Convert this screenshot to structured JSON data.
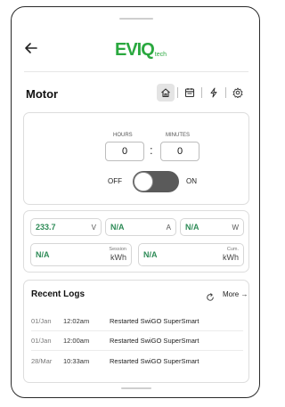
{
  "header": {
    "logo_main": "EVIQ",
    "logo_sub": "tech"
  },
  "device": {
    "title": "Motor",
    "nav": [
      {
        "icon": "home-icon",
        "active": true
      },
      {
        "icon": "calendar-icon",
        "active": false
      },
      {
        "icon": "lightning-icon",
        "active": false
      },
      {
        "icon": "gear-icon",
        "active": false
      }
    ]
  },
  "timer": {
    "hours_label": "HOURS",
    "minutes_label": "MINUTES",
    "hours_value": "0",
    "minutes_value": "0",
    "separator": ":",
    "off_label": "OFF",
    "on_label": "ON",
    "toggle_state": "off"
  },
  "metrics": {
    "voltage": {
      "value": "233.7",
      "unit": "V"
    },
    "current": {
      "value": "N/A",
      "unit": "A"
    },
    "power": {
      "value": "N/A",
      "unit": "W"
    },
    "session": {
      "value": "N/A",
      "label": "Session",
      "unit": "kWh"
    },
    "cumulative": {
      "value": "N/A",
      "label": "Cum.",
      "unit": "kWh"
    }
  },
  "logs": {
    "title": "Recent Logs",
    "more_label": "More",
    "more_arrow": "→",
    "rows": [
      {
        "date": "01/Jan",
        "time": "12:02am",
        "message": "Restarted SwiGO SuperSmart"
      },
      {
        "date": "01/Jan",
        "time": "12:00am",
        "message": "Restarted SwiGO SuperSmart"
      },
      {
        "date": "28/Mar",
        "time": "10:33am",
        "message": "Restarted SwiGO SuperSmart"
      }
    ]
  },
  "colors": {
    "brand": "#2aa83f",
    "value_text": "#2e8b57",
    "toggle_track": "#5a5a5a"
  }
}
